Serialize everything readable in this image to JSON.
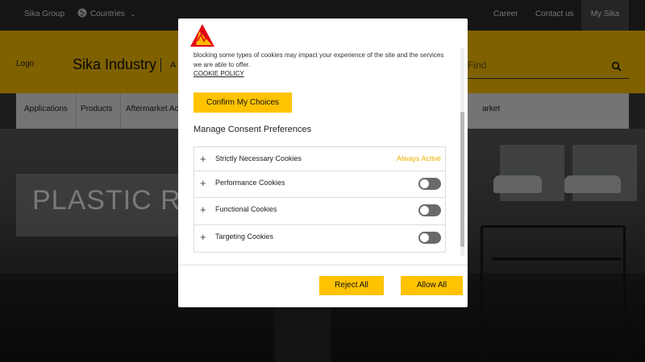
{
  "topbar": {
    "group": "Sika Group",
    "countries": "Countries",
    "career": "Career",
    "contact": "Contact us",
    "my_sika": "My Sika"
  },
  "header": {
    "logo": "Logo",
    "brand": "Sika Industry",
    "brand_sub": "A",
    "find": "Find"
  },
  "nav": {
    "items": [
      "Applications",
      "Products",
      "Aftermarket Ac",
      "arket"
    ]
  },
  "hero": {
    "title": "PLASTIC REP"
  },
  "modal": {
    "intro": "blocking some types of cookies may impact your experience of the site and the services we are able to offer.",
    "policy": "COOKIE POLICY",
    "confirm": "Confirm My Choices",
    "manage_title": "Manage Consent Preferences",
    "categories": [
      {
        "label": "Strictly Necessary Cookies",
        "status": "Always Active"
      },
      {
        "label": "Performance Cookies",
        "enabled": false
      },
      {
        "label": "Functional Cookies",
        "enabled": false
      },
      {
        "label": "Targeting Cookies",
        "enabled": false
      }
    ],
    "plus": "+",
    "reject": "Reject All",
    "allow": "Allow All"
  },
  "colors": {
    "accent": "#ffc300",
    "always_active": "#f0b000",
    "toggle_off": "#6a6a6a"
  }
}
